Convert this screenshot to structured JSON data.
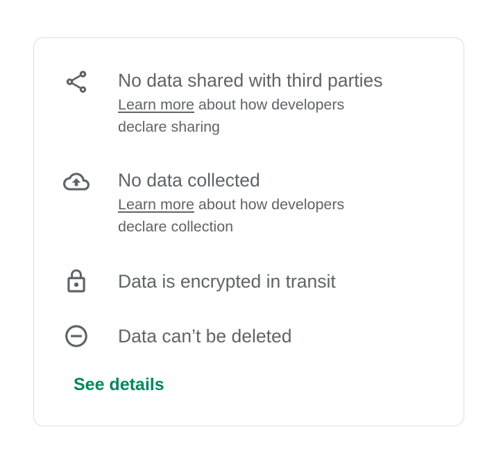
{
  "items": [
    {
      "icon": "share-icon",
      "title": "No data shared with third parties",
      "link_text": "Learn more",
      "description_after_link": " about how developers",
      "description_line2": "declare sharing"
    },
    {
      "icon": "cloud-upload-icon",
      "title": "No data collected",
      "link_text": "Learn more",
      "description_after_link": " about how developers",
      "description_line2": "declare collection"
    },
    {
      "icon": "lock-icon",
      "title": "Data is encrypted in transit"
    },
    {
      "icon": "minus-circle-icon",
      "title": "Data can’t be deleted"
    }
  ],
  "see_details_label": "See details",
  "colors": {
    "text": "#5f6368",
    "accent": "#01875f",
    "border": "#dadce0"
  }
}
